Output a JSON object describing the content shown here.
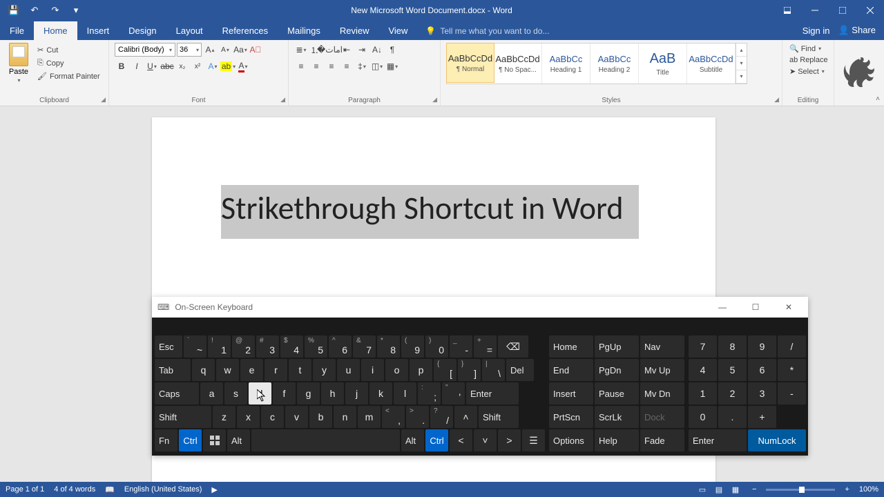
{
  "qat": {
    "save": "💾",
    "undo": "↶",
    "redo": "↷",
    "more": "▾"
  },
  "title": "New Microsoft Word Document.docx - Word",
  "tabs": {
    "file": "File",
    "items": [
      "Home",
      "Insert",
      "Design",
      "Layout",
      "References",
      "Mailings",
      "Review",
      "View"
    ],
    "active": "Home",
    "tellme_placeholder": "Tell me what you want to do...",
    "signin": "Sign in",
    "share": "Share"
  },
  "clipboard": {
    "paste": "Paste",
    "cut": "Cut",
    "copy": "Copy",
    "format_painter": "Format Painter",
    "label": "Clipboard"
  },
  "font": {
    "name": "Calibri (Body)",
    "size": "36",
    "label": "Font"
  },
  "paragraph": {
    "label": "Paragraph"
  },
  "styles": {
    "label": "Styles",
    "items": [
      {
        "prev": "AaBbCcDd",
        "name": "¶ Normal",
        "sel": true
      },
      {
        "prev": "AaBbCcDd",
        "name": "¶ No Spac..."
      },
      {
        "prev": "AaBbCc",
        "name": "Heading 1",
        "h": true
      },
      {
        "prev": "AaBbCc",
        "name": "Heading 2",
        "h": true
      },
      {
        "prev": "AaB",
        "name": "Title",
        "big": true
      },
      {
        "prev": "AaBbCcDd",
        "name": "Subtitle",
        "h": true
      }
    ]
  },
  "editing": {
    "find": "Find",
    "replace": "Replace",
    "select": "Select",
    "label": "Editing"
  },
  "document": {
    "selected_text": "Strikethrough Shortcut in Word"
  },
  "osk": {
    "title": "On-Screen Keyboard",
    "row1_func": "Esc",
    "row1": [
      {
        "s": "`",
        "m": "~"
      },
      {
        "s": "!",
        "m": "1"
      },
      {
        "s": "@",
        "m": "2"
      },
      {
        "s": "#",
        "m": "3"
      },
      {
        "s": "$",
        "m": "4"
      },
      {
        "s": "%",
        "m": "5"
      },
      {
        "s": "^",
        "m": "6"
      },
      {
        "s": "&",
        "m": "7"
      },
      {
        "s": "*",
        "m": "8"
      },
      {
        "s": "(",
        "m": "9"
      },
      {
        "s": ")",
        "m": "0"
      },
      {
        "s": "_",
        "m": "-"
      },
      {
        "s": "+",
        "m": "="
      }
    ],
    "bksp": "⌫",
    "row2_func": "Tab",
    "row2": [
      "q",
      "w",
      "e",
      "r",
      "t",
      "y",
      "u",
      "i",
      "o",
      "p"
    ],
    "row2_end": [
      {
        "s": "{",
        "m": "["
      },
      {
        "s": "}",
        "m": "]"
      },
      {
        "s": "|",
        "m": "\\"
      }
    ],
    "del": "Del",
    "row3_func": "Caps",
    "row3": [
      "a",
      "s",
      "d",
      "f",
      "g",
      "h",
      "j",
      "k",
      "l"
    ],
    "row3_end": [
      {
        "s": ":",
        "m": ";"
      },
      {
        "s": "\"",
        "m": "'"
      }
    ],
    "enter": "Enter",
    "row4_func": "Shift",
    "row4": [
      "z",
      "x",
      "c",
      "v",
      "b",
      "n",
      "m"
    ],
    "row4_end": [
      {
        "s": "<",
        "m": ","
      },
      {
        "s": ">",
        "m": "."
      },
      {
        "s": "?",
        "m": "/"
      }
    ],
    "shift_r": "Shift",
    "row5": {
      "fn": "Fn",
      "ctrl": "Ctrl",
      "alt": "Alt",
      "altgr": "Alt",
      "ctrl_r": "Ctrl"
    },
    "nav": [
      [
        "Home",
        "PgUp",
        "Nav"
      ],
      [
        "End",
        "PgDn",
        "Mv Up"
      ],
      [
        "Insert",
        "Pause",
        "Mv Dn"
      ],
      [
        "PrtScn",
        "ScrLk",
        "Dock"
      ],
      [
        "Options",
        "Help",
        "Fade"
      ]
    ],
    "numpad": [
      [
        "7",
        "8",
        "9",
        "/"
      ],
      [
        "4",
        "5",
        "6",
        "*"
      ],
      [
        "1",
        "2",
        "3",
        "-"
      ],
      [
        "0",
        ".",
        "+"
      ],
      [
        "Enter",
        "NumLock"
      ]
    ]
  },
  "status": {
    "page": "Page 1 of 1",
    "words": "4 of 4 words",
    "lang": "English (United States)",
    "zoom": "100%"
  }
}
